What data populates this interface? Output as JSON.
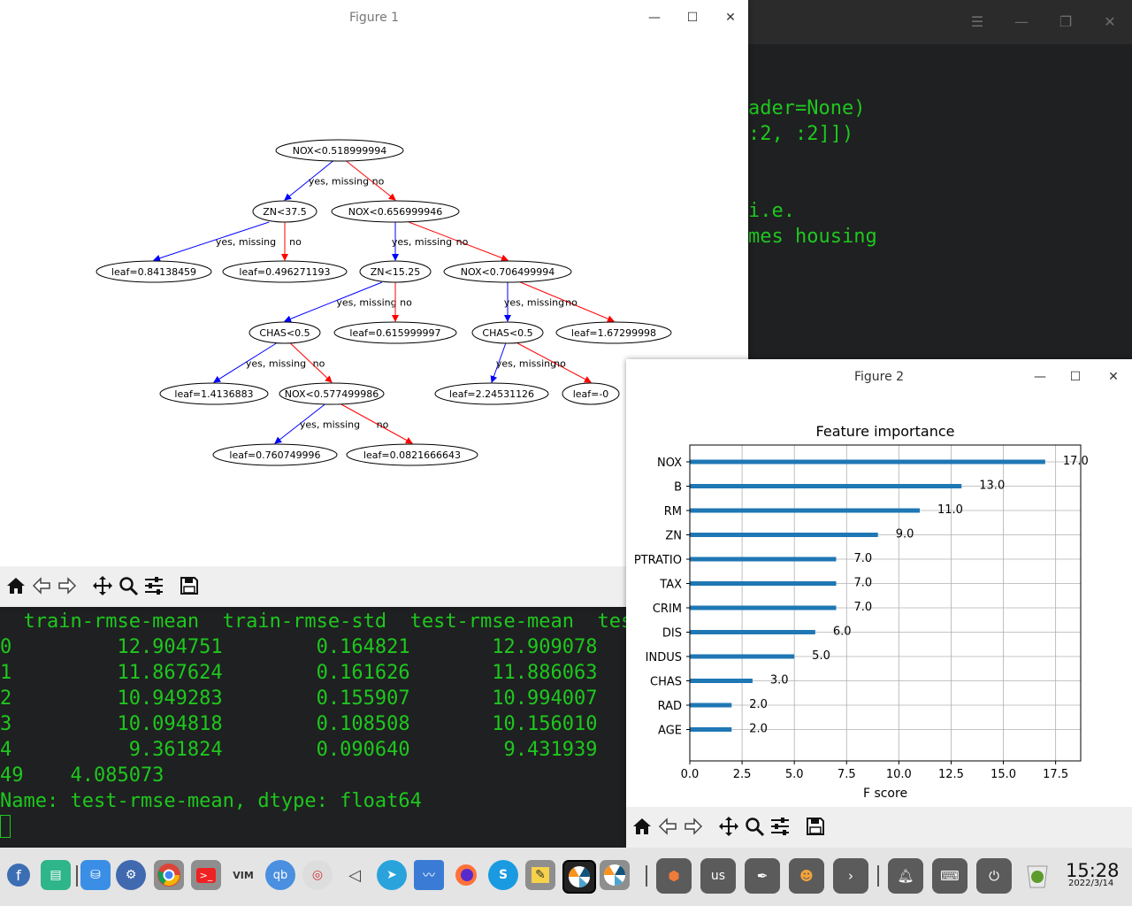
{
  "terminal": {
    "code_lines": [
      "ader=None)",
      ":2, :2]])",
      "i.e.",
      "mes housing"
    ],
    "table_header": "  train-rmse-mean  train-rmse-std  test-rmse-mean  tes",
    "rows": [
      "0         12.904751        0.164821       12.909078",
      "1         11.867624        0.161626       11.886063",
      "2         10.949283        0.155907       10.994007",
      "3         10.094818        0.108508       10.156010",
      "4          9.361824        0.090640        9.431939"
    ],
    "last_value": "49    4.085073",
    "name_line": "Name: test-rmse-mean, dtype: float64"
  },
  "figure1": {
    "title": "Figure 1",
    "tree": {
      "nodes": [
        {
          "id": "n0",
          "label": "NOX<0.518999994"
        },
        {
          "id": "n1",
          "label": "ZN<37.5"
        },
        {
          "id": "n2",
          "label": "NOX<0.656999946"
        },
        {
          "id": "n3",
          "label": "leaf=0.84138459"
        },
        {
          "id": "n4",
          "label": "leaf=0.496271193"
        },
        {
          "id": "n5",
          "label": "ZN<15.25"
        },
        {
          "id": "n6",
          "label": "NOX<0.706499994"
        },
        {
          "id": "n7",
          "label": "CHAS<0.5"
        },
        {
          "id": "n8",
          "label": "leaf=0.615999997"
        },
        {
          "id": "n9",
          "label": "CHAS<0.5"
        },
        {
          "id": "n10",
          "label": "leaf=1.67299998"
        },
        {
          "id": "n11",
          "label": "leaf=1.4136883"
        },
        {
          "id": "n12",
          "label": "NOX<0.577499986"
        },
        {
          "id": "n13",
          "label": "leaf=2.24531126"
        },
        {
          "id": "n14",
          "label": "leaf=-0"
        },
        {
          "id": "n15",
          "label": "leaf=0.760749996"
        },
        {
          "id": "n16",
          "label": "leaf=0.0821666643"
        }
      ],
      "yes_label": "yes, missing",
      "no_label": "no"
    }
  },
  "figure2": {
    "title": "Figure 2"
  },
  "chart_data": {
    "type": "bar",
    "orientation": "horizontal",
    "title": "Feature importance",
    "xlabel": "F score",
    "ylabel": "",
    "categories": [
      "NOX",
      "B",
      "RM",
      "ZN",
      "PTRATIO",
      "TAX",
      "CRIM",
      "DIS",
      "INDUS",
      "CHAS",
      "RAD",
      "AGE"
    ],
    "values": [
      17.0,
      13.0,
      11.0,
      9.0,
      7.0,
      7.0,
      7.0,
      6.0,
      5.0,
      3.0,
      2.0,
      2.0
    ],
    "value_labels": [
      "17.0",
      "13.0",
      "11.0",
      "9.0",
      "7.0",
      "7.0",
      "7.0",
      "6.0",
      "5.0",
      "3.0",
      "2.0",
      "2.0"
    ],
    "xticks": [
      "0.0",
      "2.5",
      "5.0",
      "7.5",
      "10.0",
      "12.5",
      "15.0",
      "17.5"
    ],
    "xlim": [
      0,
      18.7
    ],
    "grid": true,
    "bar_color": "#1f77b4"
  },
  "colors": {
    "yes_edge": "#0000ff",
    "no_edge": "#ff0000",
    "terminal_text": "#1ec71e"
  },
  "taskbar": {
    "keyboard_layout": "us",
    "time": "15:28",
    "date": "2022/3/14"
  }
}
